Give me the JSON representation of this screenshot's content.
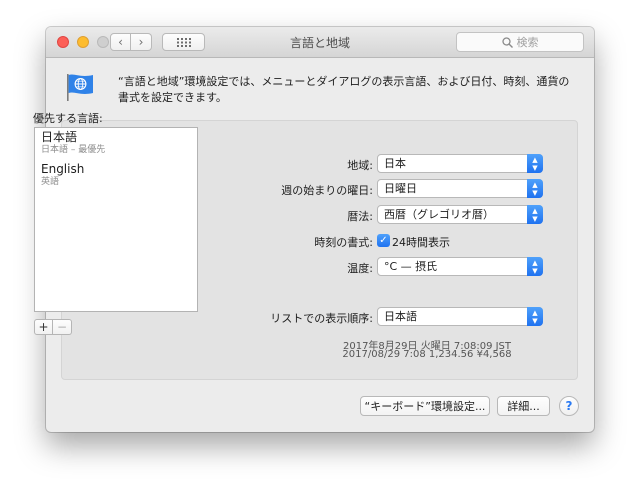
{
  "window": {
    "title": "言語と地域",
    "search_placeholder": "検索",
    "icons": {
      "back": "chevron-left-icon",
      "forward": "chevron-right-icon",
      "grid": "grid-icon",
      "search": "magnifier-icon",
      "pane": "flag-globe-icon"
    }
  },
  "description": "“言語と地域”環境設定では、メニューとダイアログの表示言語、および日付、時刻、通貨の書式を設定できます。",
  "languages": {
    "heading": "優先する言語:",
    "items": [
      {
        "name": "日本語",
        "sub": "日本語 – 最優先"
      },
      {
        "name": "English",
        "sub": "英語"
      }
    ],
    "add_label": "+",
    "remove_label": "−"
  },
  "settings": {
    "region": {
      "label": "地域:",
      "value": "日本"
    },
    "week_start": {
      "label": "週の始まりの曜日:",
      "value": "日曜日"
    },
    "calendar": {
      "label": "暦法:",
      "value": "西暦（グレゴリオ暦）"
    },
    "time_format": {
      "label": "時刻の書式:",
      "check_label": "24時間表示",
      "checked": true
    },
    "temperature": {
      "label": "温度:",
      "value": "°C — 摂氏"
    },
    "list_order": {
      "label": "リストでの表示順序:",
      "value": "日本語"
    }
  },
  "sample": {
    "line1": "2017年8月29日 火曜日 7:08:09 JST",
    "line2": "2017/08/29 7:08     1,234.56     ¥4,568"
  },
  "buttons": {
    "keyboard": "“キーボード”環境設定...",
    "advanced": "詳細...",
    "help": "?"
  },
  "colors": {
    "accent": "#2a7af3",
    "close": "#fc5f57",
    "minimize": "#fdbc2e"
  }
}
